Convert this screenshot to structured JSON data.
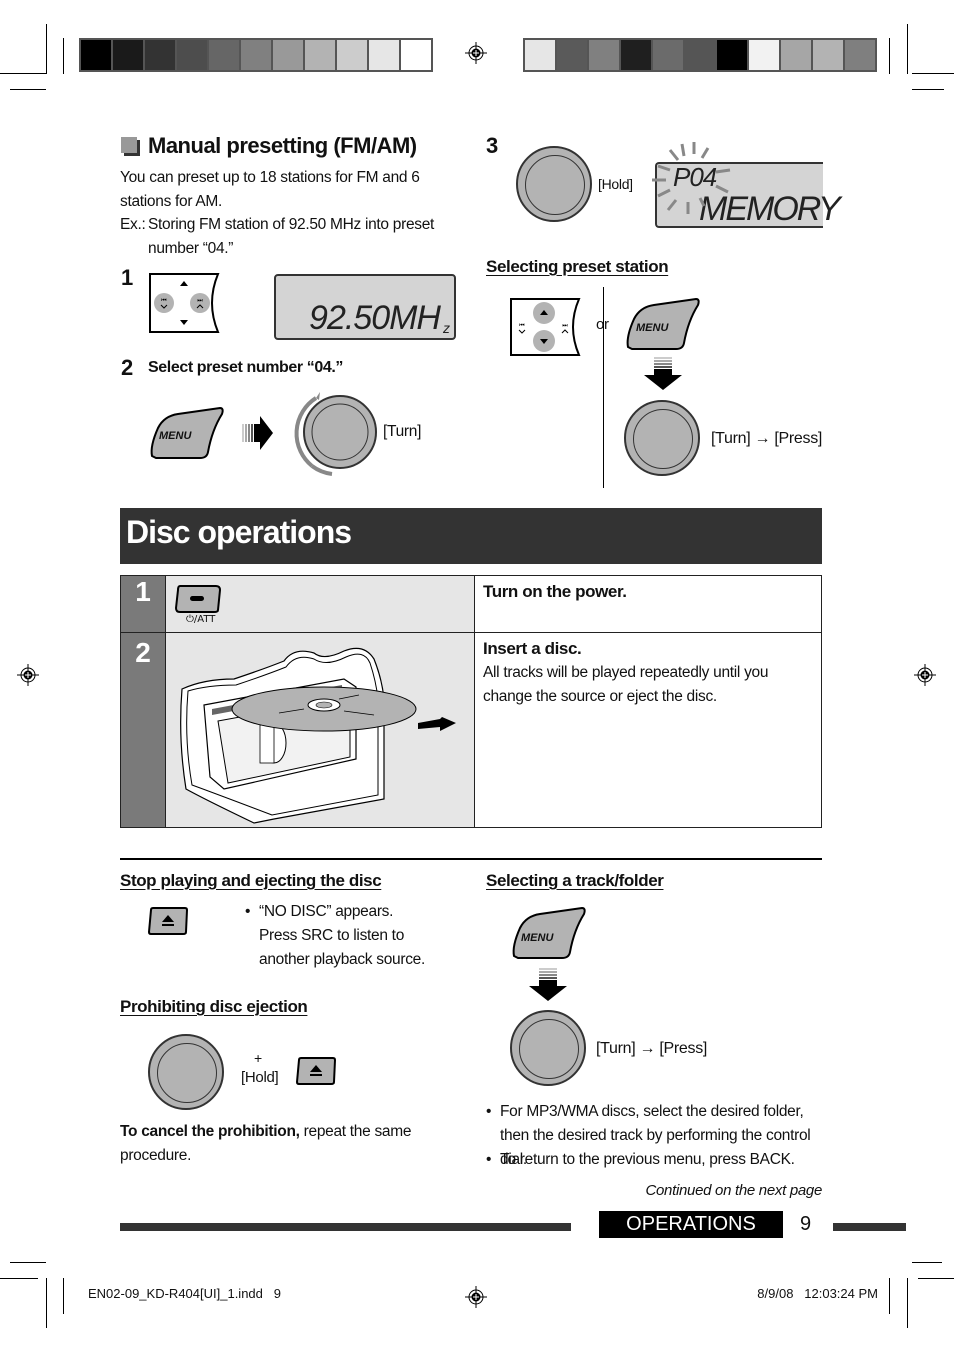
{
  "printer_marks": {
    "left_bar_grays": [
      "#000000",
      "#1a1a1a",
      "#333333",
      "#4d4d4d",
      "#666666",
      "#808080",
      "#999999",
      "#b3b3b3",
      "#cccccc",
      "#e6e6e6",
      "#ffffff"
    ],
    "right_bar_grays": [
      "#e6e6e6",
      "#5a5a5a",
      "#808080",
      "#1f1f1f",
      "#6b6b6b",
      "#555555",
      "#000000",
      "#f2f2f2",
      "#a6a6a6",
      "#b3b3b3",
      "#7f7f7f"
    ]
  },
  "manual_presetting": {
    "title": "Manual presetting (FM/AM)",
    "intro": "You can preset up to 18 stations for FM and 6 stations for AM.",
    "example_label": "Ex.:",
    "example_text": "Storing FM station of 92.50 MHz into preset number “04.”",
    "step1": {
      "num": "1",
      "display": "92.50MH",
      "display_suffix": "z"
    },
    "step2": {
      "num": "2",
      "text": "Select preset number “04.”",
      "menu_label": "MENU",
      "dial_action": "[Turn]"
    },
    "step3": {
      "num": "3",
      "dial_action": "[Hold]",
      "display_top": "P04",
      "display_bottom": "MEMORY"
    }
  },
  "selecting_preset": {
    "title": "Selecting preset station",
    "or_label": "or",
    "menu_label": "MENU",
    "dial_action": "[Turn] → [Press]"
  },
  "disc_operations": {
    "title": "Disc operations",
    "steps": [
      {
        "num": "1",
        "button_label": "⏻/ATT",
        "heading": "Turn on the power.",
        "body": ""
      },
      {
        "num": "2",
        "heading": "Insert a disc.",
        "body": "All tracks will be played repeatedly until you change the source or eject the disc."
      }
    ]
  },
  "stop_ejecting": {
    "title": "Stop playing and ejecting the disc",
    "bullet_line1": "“NO DISC” appears.",
    "bullet_line2": "Press SRC to listen to another playback source."
  },
  "prohibiting": {
    "title": "Prohibiting disc ejection",
    "plus": "+",
    "hold": "[Hold]",
    "cancel_bold": "To cancel the prohibition,",
    "cancel_rest": " repeat the same procedure."
  },
  "selecting_track": {
    "title": "Selecting a track/folder",
    "menu_label": "MENU",
    "dial_action": "[Turn] → [Press]",
    "bullets": [
      "For MP3/WMA discs, select the desired folder, then the desired track by performing the control dial.",
      "To return to the previous menu, press BACK."
    ]
  },
  "continued": "Continued on the next page",
  "footer": {
    "section": "OPERATIONS",
    "page": "9"
  },
  "slug": {
    "file": "EN02-09_KD-R404[UI]_1.indd   9",
    "date": "8/9/08   12:03:24 PM"
  }
}
